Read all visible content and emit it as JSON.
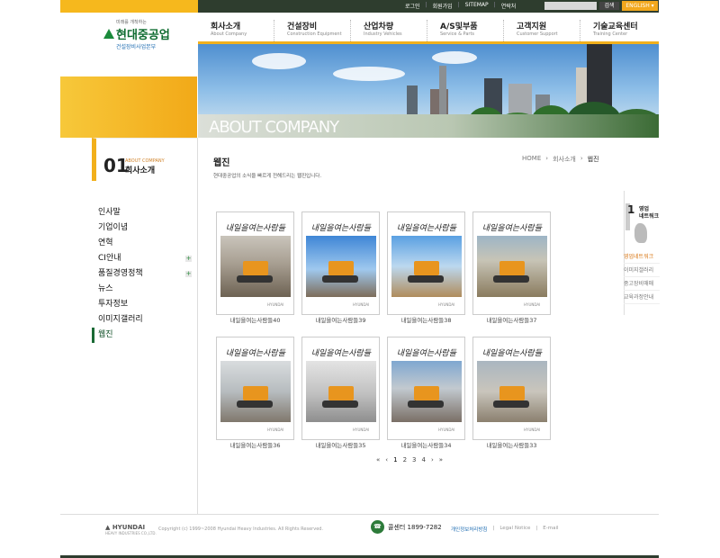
{
  "header": {
    "top_links": [
      "로그인",
      "회원가입",
      "SITEMAP",
      "연락처"
    ],
    "search_button": "검색",
    "language": "ENGLISH ▾"
  },
  "logo": {
    "tagline": "미래를 개척하는",
    "name": "현대중공업",
    "division": "건설장비사업본부"
  },
  "gnb": [
    {
      "ko": "회사소개",
      "en": "About Company"
    },
    {
      "ko": "건설장비",
      "en": "Construction Equipment"
    },
    {
      "ko": "산업차량",
      "en": "Industry Vehicles"
    },
    {
      "ko": "A/S및부품",
      "en": "Service & Parts"
    },
    {
      "ko": "고객지원",
      "en": "Customer Support"
    },
    {
      "ko": "기술교육센터",
      "en": "Training Center"
    }
  ],
  "hero": {
    "title": "ABOUT COMPANY"
  },
  "section": {
    "num": "01",
    "en": "ABOUT COMPANY",
    "ko": "회사소개"
  },
  "lnb": [
    {
      "label": "인사말",
      "plus": false,
      "active": false
    },
    {
      "label": "기업이념",
      "plus": false,
      "active": false
    },
    {
      "label": "연혁",
      "plus": false,
      "active": false
    },
    {
      "label": "CI안내",
      "plus": true,
      "active": false
    },
    {
      "label": "품질경영정책",
      "plus": true,
      "active": false
    },
    {
      "label": "뉴스",
      "plus": false,
      "active": false
    },
    {
      "label": "투자정보",
      "plus": false,
      "active": false
    },
    {
      "label": "이미지갤러리",
      "plus": false,
      "active": false
    },
    {
      "label": "웹진",
      "plus": false,
      "active": true
    }
  ],
  "content": {
    "title": "웹진",
    "description": "현대중공업의 소식을 빠르게 전해드리는 웹진입니다.",
    "breadcrumb": [
      "HOME",
      "›",
      "회사소개",
      "›",
      "웹진"
    ]
  },
  "magazines": [
    {
      "caption": "내일을여는사람들40",
      "theme": "wheel-loader"
    },
    {
      "caption": "내일을여는사람들39",
      "theme": "excavator-sky"
    },
    {
      "caption": "내일을여는사람들38",
      "theme": "field"
    },
    {
      "caption": "내일을여는사람들37",
      "theme": "city-excavator"
    },
    {
      "caption": "내일을여는사람들36",
      "theme": "quarry"
    },
    {
      "caption": "내일을여는사람들35",
      "theme": "parts"
    },
    {
      "caption": "내일을여는사람들34",
      "theme": "demolition"
    },
    {
      "caption": "내일을여는사람들33",
      "theme": "loader-truck"
    }
  ],
  "cover_title": "내일을여는사람들",
  "pager": {
    "first": "«",
    "prev": "‹",
    "pages": [
      "1",
      "2",
      "3",
      "4"
    ],
    "next": "›",
    "last": "»"
  },
  "quick": {
    "num": "1",
    "title_line1": "영업",
    "title_line2": "네트워크",
    "links": [
      "영업네트워크",
      "이미지갤러리",
      "중고장비매매",
      "교육과정안내"
    ]
  },
  "footer": {
    "logo": "HYUNDAI",
    "logo_sub": "HEAVY INDUSTRIES CO.,LTD.",
    "copyright": "Copyright (c) 1999~2008 Hyundai Heavy Industries. All Rights Reserved.",
    "callcenter": "콜센터 1899-7282",
    "links": [
      "개인정보처리방침",
      "Legal Notice",
      "E-mail"
    ]
  },
  "colors": {
    "accent": "#f2b01c",
    "brand": "#0e6b2f",
    "dark": "#2e3d2e"
  }
}
